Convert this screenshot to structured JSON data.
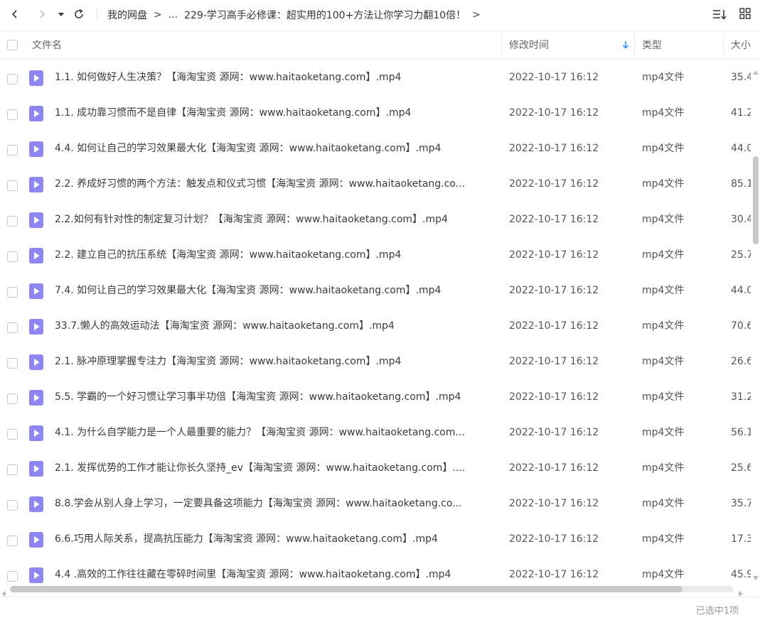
{
  "toolbar": {
    "icons": [
      "chevron-left-icon",
      "chevron-right-icon",
      "caret-down-icon",
      "refresh-icon",
      "sort-list-icon",
      "grid-view-icon"
    ]
  },
  "breadcrumb": {
    "root": "我的网盘",
    "ellipsis": "...",
    "current": "229-学习高手必修课：超实用的100+方法让你学习力翻10倍！",
    "separator": ">"
  },
  "columns": {
    "name": "文件名",
    "modified": "修改时间",
    "type": "类型",
    "size": "大小"
  },
  "files": [
    {
      "name": "1.1. 如何做好人生决策？【海淘宝资 源网：www.haitaoketang.com】.mp4",
      "modified": "2022-10-17 16:12",
      "type": "mp4文件",
      "size": "35.4"
    },
    {
      "name": "1.1. 成功靠习惯而不是自律【海淘宝资 源网：www.haitaoketang.com】.mp4",
      "modified": "2022-10-17 16:12",
      "type": "mp4文件",
      "size": "41.2"
    },
    {
      "name": "4.4. 如何让自己的学习效果最大化【海淘宝资 源网：www.haitaoketang.com】.mp4",
      "modified": "2022-10-17 16:12",
      "type": "mp4文件",
      "size": "44.0"
    },
    {
      "name": "2.2. 养成好习惯的两个方法：触发点和仪式习惯【海淘宝资 源网：www.haitaoketang.co...",
      "modified": "2022-10-17 16:12",
      "type": "mp4文件",
      "size": "85.1"
    },
    {
      "name": "2.2.如何有针对性的制定复习计划？【海淘宝资 源网：www.haitaoketang.com】.mp4",
      "modified": "2022-10-17 16:12",
      "type": "mp4文件",
      "size": "30.4"
    },
    {
      "name": "2.2. 建立自己的抗压系统【海淘宝资 源网：www.haitaoketang.com】.mp4",
      "modified": "2022-10-17 16:12",
      "type": "mp4文件",
      "size": "25.7"
    },
    {
      "name": "7.4. 如何让自己的学习效果最大化【海淘宝资 源网：www.haitaoketang.com】.mp4",
      "modified": "2022-10-17 16:12",
      "type": "mp4文件",
      "size": "44.0"
    },
    {
      "name": "33.7.懒人的高效运动法【海淘宝资 源网：www.haitaoketang.com】.mp4",
      "modified": "2022-10-17 16:12",
      "type": "mp4文件",
      "size": "70.6"
    },
    {
      "name": "2.1. 脉冲原理掌握专注力【海淘宝资 源网：www.haitaoketang.com】.mp4",
      "modified": "2022-10-17 16:12",
      "type": "mp4文件",
      "size": "26.6"
    },
    {
      "name": "5.5. 学霸的一个好习惯让学习事半功倍【海淘宝资 源网：www.haitaoketang.com】.mp4",
      "modified": "2022-10-17 16:12",
      "type": "mp4文件",
      "size": "31.2"
    },
    {
      "name": "4.1. 为什么自学能力是一个人最重要的能力？【海淘宝资 源网：www.haitaoketang.com...",
      "modified": "2022-10-17 16:12",
      "type": "mp4文件",
      "size": "56.1"
    },
    {
      "name": "2.1. 发挥优势的工作才能让你长久坚持_ev【海淘宝资 源网：www.haitaoketang.com】....",
      "modified": "2022-10-17 16:12",
      "type": "mp4文件",
      "size": "25.6"
    },
    {
      "name": "8.8.学会从别人身上学习，一定要具备这项能力【海淘宝资 源网：www.haitaoketang.co...",
      "modified": "2022-10-17 16:12",
      "type": "mp4文件",
      "size": "35.7"
    },
    {
      "name": "6.6.巧用人际关系，提高抗压能力【海淘宝资 源网：www.haitaoketang.com】.mp4",
      "modified": "2022-10-17 16:12",
      "type": "mp4文件",
      "size": "17.3"
    },
    {
      "name": "4.4 .高效的工作往往藏在零碎时间里【海淘宝资 源网：www.haitaoketang.com】.mp4",
      "modified": "2022-10-17 16:12",
      "type": "mp4文件",
      "size": "45.9"
    }
  ],
  "file_icon": "video-file-icon",
  "colors": {
    "file_icon": "#8e86f2",
    "sort_arrow": "#2e8fff"
  },
  "status": {
    "selection": "已选中1项"
  }
}
